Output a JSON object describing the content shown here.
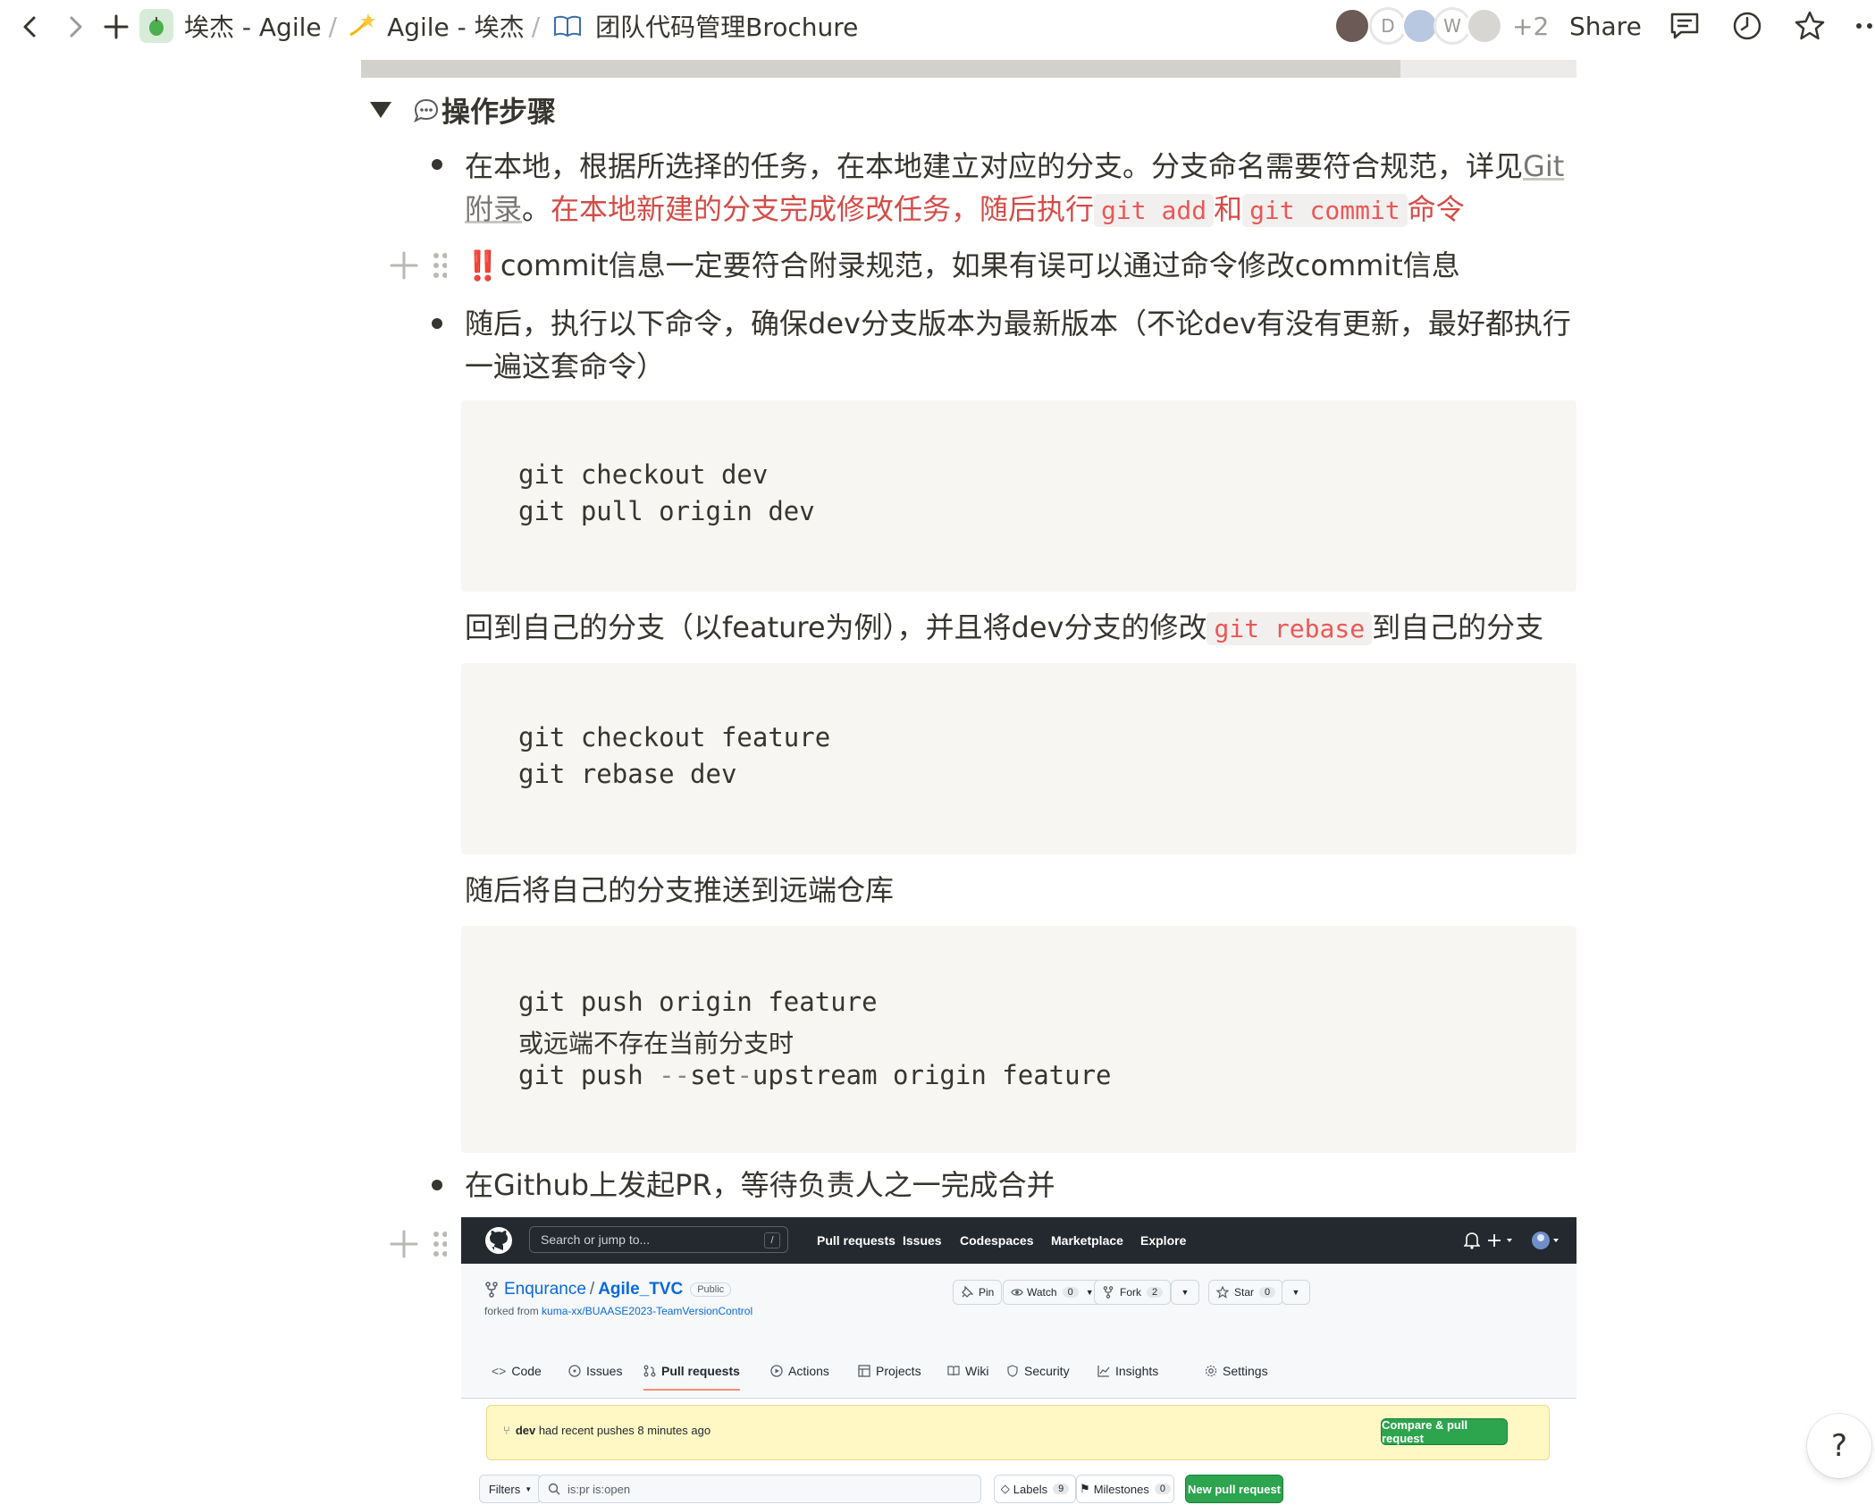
{
  "topbar": {
    "crumb1": "埃杰 - Agile",
    "crumb2": "Agile - 埃杰",
    "crumb3": "团队代码管理Brochure",
    "sep": "/",
    "avatars": [
      "",
      "D",
      "",
      "W",
      ""
    ],
    "more_count": "+2",
    "share": "Share"
  },
  "progress": {
    "fraction": 0.855
  },
  "section": {
    "title": "操作步骤",
    "bullet1": {
      "text1": "在本地，根据所选择的任务，在本地建立对应的分支。分支命名需要符合规范，详见",
      "link": "Git附录",
      "text2": "。",
      "red1": "在本地新建的分支完成修改任务，随后执行",
      "code1": "git add",
      "red2": "和",
      "code2": "git commit",
      "red3": "命令"
    },
    "warning": {
      "mark": "‼️",
      "text": "commit信息一定要符合附录规范，如果有误可以通过命令修改commit信息"
    },
    "bullet2": "随后，执行以下命令，确保dev分支版本为最新版本（不论dev有没有更新，最好都执行一遍这套命令）",
    "code_block1": [
      "git checkout dev",
      "git pull origin dev"
    ],
    "para_rebase": {
      "text1": "回到自己的分支（以feature为例），并且将dev分支的修改",
      "code": "git rebase",
      "text2": "到自己的分支"
    },
    "code_block2": [
      "git checkout feature",
      "git rebase dev"
    ],
    "para_push": "随后将自己的分支推送到远端仓库",
    "code_block3": {
      "line1": "git push origin feature",
      "line2": "或远端不存在当前分支时",
      "line3a": "git push ",
      "line3b": "--",
      "line3c": "set",
      "line3d": "-",
      "line3e": "upstream origin feature"
    },
    "bullet3": "在Github上发起PR，等待负责人之一完成合并"
  },
  "github": {
    "search_placeholder": "Search or jump to...",
    "slash": "/",
    "nav": [
      "Pull requests",
      "Issues",
      "Codespaces",
      "Marketplace",
      "Explore"
    ],
    "owner": "Enqurance",
    "slash_sep": "/",
    "repo": "Agile_TVC",
    "visibility": "Public",
    "forked_label": "forked from ",
    "forked_repo": "kuma-xx/BUAASE2023-TeamVersionControl",
    "pin": "Pin",
    "watch": "Watch",
    "watch_count": "0",
    "fork": "Fork",
    "fork_count": "2",
    "star": "Star",
    "star_count": "0",
    "tabs": [
      "Code",
      "Issues",
      "Pull requests",
      "Actions",
      "Projects",
      "Wiki",
      "Security",
      "Insights",
      "Settings"
    ],
    "banner_branch": "dev",
    "banner_text": " had recent pushes 8 minutes ago",
    "compare_button": "Compare & pull request",
    "filters": "Filters",
    "filter_query": "is:pr is:open",
    "labels": "Labels",
    "labels_count": "9",
    "milestones": "Milestones",
    "milestones_count": "0",
    "new_pr": "New pull request"
  },
  "help": "?"
}
